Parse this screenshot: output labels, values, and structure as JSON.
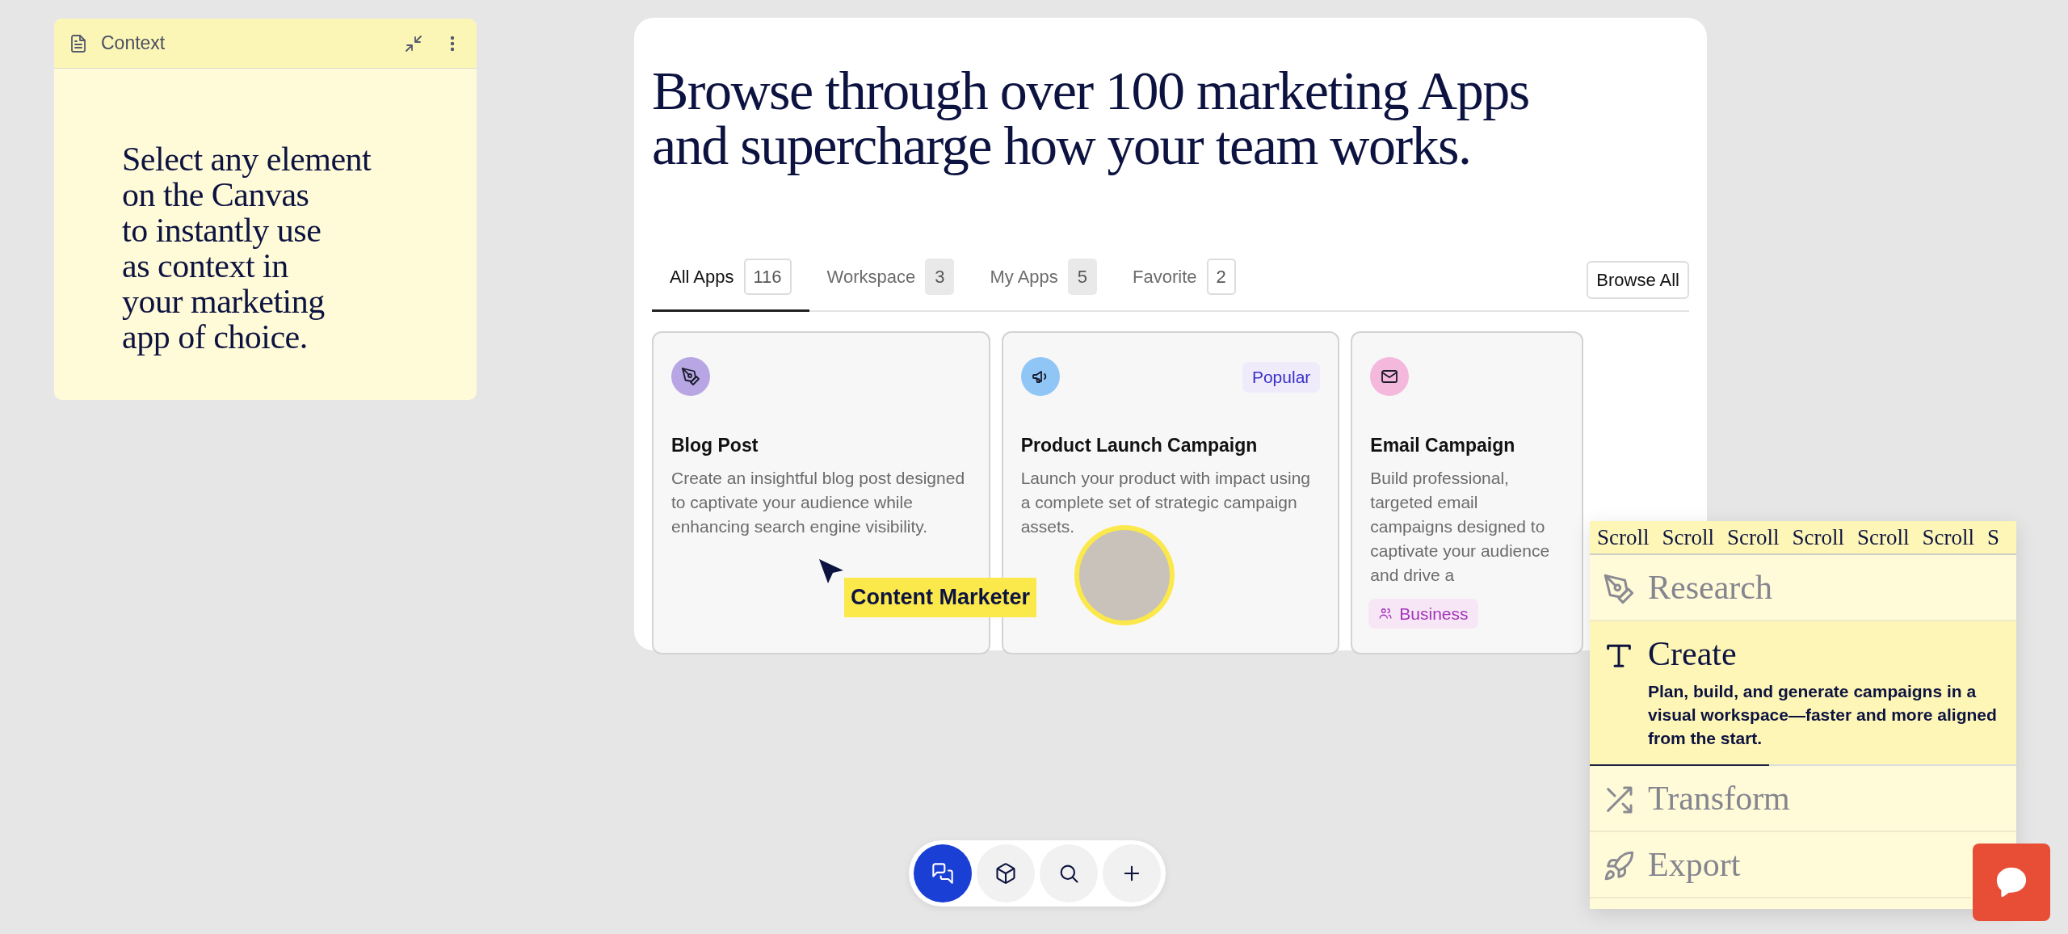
{
  "context_note": {
    "title": "Context",
    "lines": [
      "Select any element",
      "on the Canvas",
      "to instantly use",
      "as context in",
      "your marketing",
      "app of choice."
    ]
  },
  "apps_panel": {
    "heading_lines": [
      "Browse through over 100 marketing Apps",
      "and supercharge how your team works."
    ],
    "tabs": [
      {
        "label": "All Apps",
        "count": "116",
        "selected": true,
        "kind": "outlined"
      },
      {
        "label": "Workspace",
        "count": "3",
        "selected": false,
        "kind": "filled"
      },
      {
        "label": "My Apps",
        "count": "5",
        "selected": false,
        "kind": "filled"
      },
      {
        "label": "Favorite",
        "count": "2",
        "selected": false,
        "kind": "outlined"
      }
    ],
    "browse_button": "Browse All",
    "apps": [
      {
        "kind": "pen",
        "color": "#b7a6e3",
        "title": "Blog Post",
        "description": "Create an insightful blog post designed to captivate your audience while enhancing search engine visibility."
      },
      {
        "kind": "megaphone",
        "color": "#8fc6f6",
        "title": "Product Launch Campaign",
        "description": "Launch your product with impact using a complete set of strategic campaign assets.",
        "badge": {
          "label": "Popular",
          "kind": "popular"
        }
      },
      {
        "kind": "mail",
        "color": "#f4b8dd",
        "title": "Email Campaign",
        "description": "Build professional, targeted email campaigns designed to captivate your audience and drive a",
        "badge": {
          "label": "Business",
          "kind": "business"
        }
      }
    ]
  },
  "cursor_tag": {
    "label": "Content Marketer"
  },
  "steps_panel": {
    "marquee": [
      "Scroll",
      "Scroll",
      "Scroll",
      "Scroll",
      "Scroll",
      "Scroll",
      "S"
    ],
    "steps": [
      {
        "kind": "pen",
        "label": "Research",
        "selected": false
      },
      {
        "kind": "type",
        "label": "Create",
        "selected": true,
        "description": "Plan, build, and generate campaigns in a visual workspace—faster and more aligned from the start.",
        "level": 0.42
      },
      {
        "kind": "shuffle",
        "label": "Transform",
        "selected": false
      },
      {
        "kind": "rocket",
        "label": "Export",
        "selected": false
      }
    ]
  },
  "toolbar": [
    {
      "kind": "chat",
      "selected": true
    },
    {
      "kind": "cube",
      "selected": false
    },
    {
      "kind": "search",
      "selected": false
    },
    {
      "kind": "plus",
      "selected": false
    }
  ]
}
